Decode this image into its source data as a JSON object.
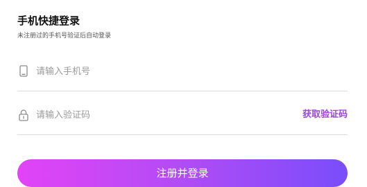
{
  "header": {
    "title": "手机快捷登录",
    "subtitle": "未注册过的手机号验证后自动登录"
  },
  "phone_field": {
    "icon": "phone-icon",
    "placeholder": "请输入手机号",
    "value": ""
  },
  "code_field": {
    "icon": "lock-icon",
    "placeholder": "请输入验证码",
    "value": "",
    "get_code_label": "获取验证码"
  },
  "submit": {
    "label": "注册并登录"
  },
  "colors": {
    "accent": "#9b45e4",
    "gradient_start": "#e243f7",
    "gradient_end": "#7a4dfb",
    "divider": "#dcdcdc",
    "placeholder": "#9a9a9a"
  }
}
